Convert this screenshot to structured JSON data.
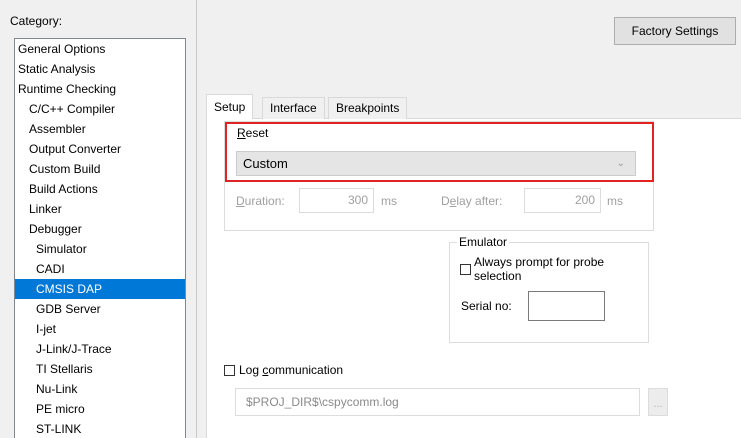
{
  "category": {
    "label": "Category:",
    "items": [
      {
        "label": "General Options",
        "indent": 0
      },
      {
        "label": "Static Analysis",
        "indent": 0
      },
      {
        "label": "Runtime Checking",
        "indent": 0
      },
      {
        "label": "C/C++ Compiler",
        "indent": 1
      },
      {
        "label": "Assembler",
        "indent": 1
      },
      {
        "label": "Output Converter",
        "indent": 1
      },
      {
        "label": "Custom Build",
        "indent": 1
      },
      {
        "label": "Build Actions",
        "indent": 1
      },
      {
        "label": "Linker",
        "indent": 1
      },
      {
        "label": "Debugger",
        "indent": 1
      },
      {
        "label": "Simulator",
        "indent": 2
      },
      {
        "label": "CADI",
        "indent": 2
      },
      {
        "label": "CMSIS DAP",
        "indent": 2,
        "selected": true
      },
      {
        "label": "GDB Server",
        "indent": 2
      },
      {
        "label": "I-jet",
        "indent": 2
      },
      {
        "label": "J-Link/J-Trace",
        "indent": 2
      },
      {
        "label": "TI Stellaris",
        "indent": 2
      },
      {
        "label": "Nu-Link",
        "indent": 2
      },
      {
        "label": "PE micro",
        "indent": 2
      },
      {
        "label": "ST-LINK",
        "indent": 2
      }
    ]
  },
  "factory_settings_label": "Factory Settings",
  "tabs": [
    {
      "label": "Setup",
      "active": true
    },
    {
      "label": "Interface",
      "active": false
    },
    {
      "label": "Breakpoints",
      "active": false
    }
  ],
  "reset": {
    "label_first": "R",
    "label_rest": "eset",
    "value": "Custom",
    "duration_label_first": "D",
    "duration_label_rest": "uration:",
    "duration_value": "300",
    "duration_unit": "ms",
    "delay_label_a": "D",
    "delay_label_u": "e",
    "delay_label_rest": "lay after:",
    "delay_value": "200",
    "delay_unit": "ms"
  },
  "emulator": {
    "title": "Emulator",
    "always_prompt_line1": "Always prompt for probe",
    "always_prompt_line2": "selection",
    "serial_label": "Serial no:",
    "serial_value": ""
  },
  "log": {
    "label_first": "Log ",
    "label_u": "c",
    "label_rest": "ommunication",
    "path": "$PROJ_DIR$\\cspycomm.log",
    "browse_label": "..."
  },
  "colors": {
    "selection": "#0078d7",
    "highlight_border": "#e02424"
  },
  "icons": {
    "dropdown": "chevron-down-icon",
    "checkbox": "checkbox-icon"
  }
}
